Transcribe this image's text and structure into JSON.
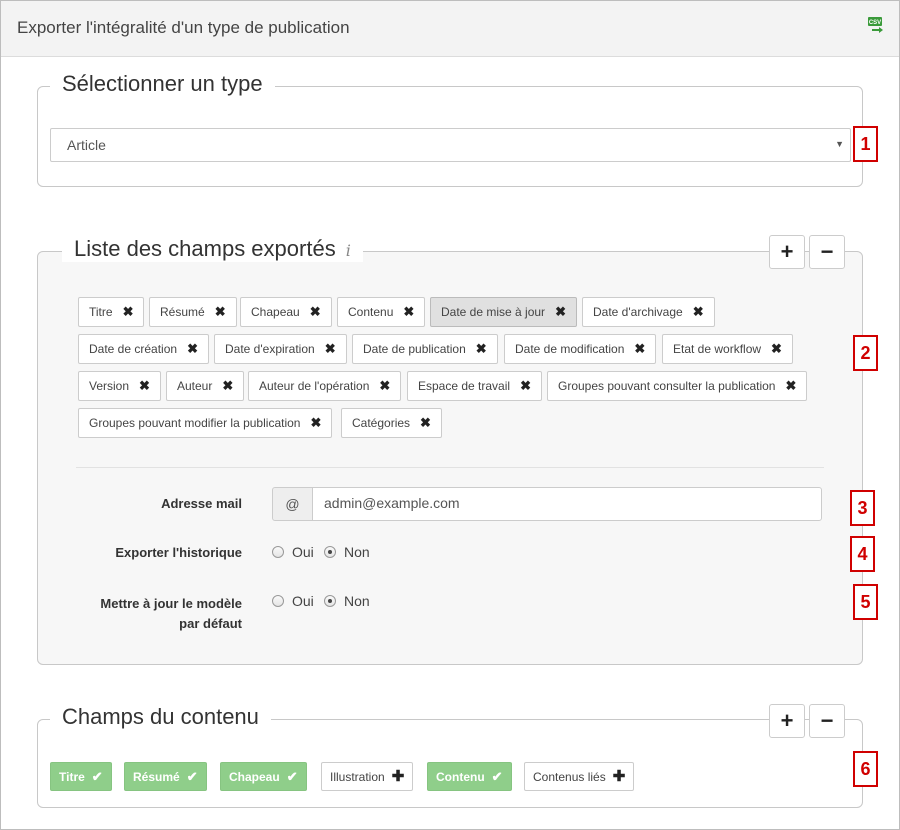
{
  "window": {
    "title": "Exporter l'intégralité d'un type de publication",
    "csv_icon_label": "CSV"
  },
  "type_section": {
    "legend": "Sélectionner un type",
    "selected": "Article",
    "number": "1"
  },
  "fields_section": {
    "legend": "Liste des champs exportés",
    "info": "i",
    "add_label": "+",
    "remove_label": "−",
    "tags": [
      "Titre",
      "Résumé",
      "Chapeau",
      "Contenu",
      "Date de mise à jour",
      "Date d'archivage",
      "Date de création",
      "Date d'expiration",
      "Date de publication",
      "Date de modification",
      "Etat de workflow",
      "Version",
      "Auteur",
      "Auteur de l'opération",
      "Espace de travail",
      "Groupes pouvant consulter la publication",
      "Groupes pouvant modifier la publication",
      "Catégories"
    ],
    "tag_remove_symbol": "✖",
    "number": "2"
  },
  "form": {
    "email_label": "Adresse mail",
    "email_addon": "@",
    "email_value": "admin@example.com",
    "email_number": "3",
    "history_label": "Exporter l'historique",
    "history_yes": "Oui",
    "history_no": "Non",
    "history_number": "4",
    "default_label_line1": "Mettre à jour le modèle",
    "default_label_line2": "par défaut",
    "default_yes": "Oui",
    "default_no": "Non",
    "default_number": "5"
  },
  "content_section": {
    "legend": "Champs du contenu",
    "add_label": "+",
    "remove_label": "−",
    "number": "6",
    "items": [
      {
        "label": "Titre",
        "selected": true,
        "symbol": "✔"
      },
      {
        "label": "Résumé",
        "selected": true,
        "symbol": "✔"
      },
      {
        "label": "Chapeau",
        "selected": true,
        "symbol": "✔"
      },
      {
        "label": "Illustration",
        "selected": false,
        "symbol": "✚"
      },
      {
        "label": "Contenu",
        "selected": true,
        "symbol": "✔"
      },
      {
        "label": "Contenus liés",
        "selected": false,
        "symbol": "✚"
      }
    ]
  },
  "colors": {
    "selected_tag": "#8fce8a",
    "marker_red": "#d00000"
  }
}
